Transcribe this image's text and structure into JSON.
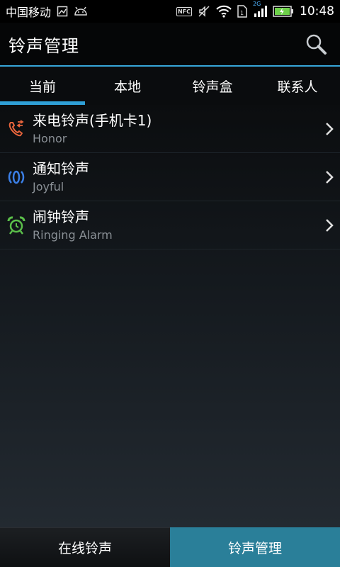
{
  "status_bar": {
    "carrier": "中国移动",
    "nfc_label": "NFC",
    "network_label": "2G",
    "time": "10:48"
  },
  "header": {
    "title": "铃声管理"
  },
  "tabs": [
    {
      "label": "当前",
      "active": true
    },
    {
      "label": "本地",
      "active": false
    },
    {
      "label": "铃声盒",
      "active": false
    },
    {
      "label": "联系人",
      "active": false
    }
  ],
  "ringtones": [
    {
      "title": "来电铃声(手机卡1)",
      "subtitle": "Honor",
      "icon": "phone-call-icon",
      "color": "#e8643c"
    },
    {
      "title": "通知铃声",
      "subtitle": "Joyful",
      "icon": "notification-speaker-icon",
      "color": "#3b7fe6"
    },
    {
      "title": "闹钟铃声",
      "subtitle": "Ringing Alarm",
      "icon": "alarm-clock-icon",
      "color": "#5bbf4a"
    }
  ],
  "bottom_nav": {
    "online": "在线铃声",
    "manage": "铃声管理"
  },
  "colors": {
    "accent": "#37a5d8",
    "bottom_active": "#2a7f99"
  }
}
